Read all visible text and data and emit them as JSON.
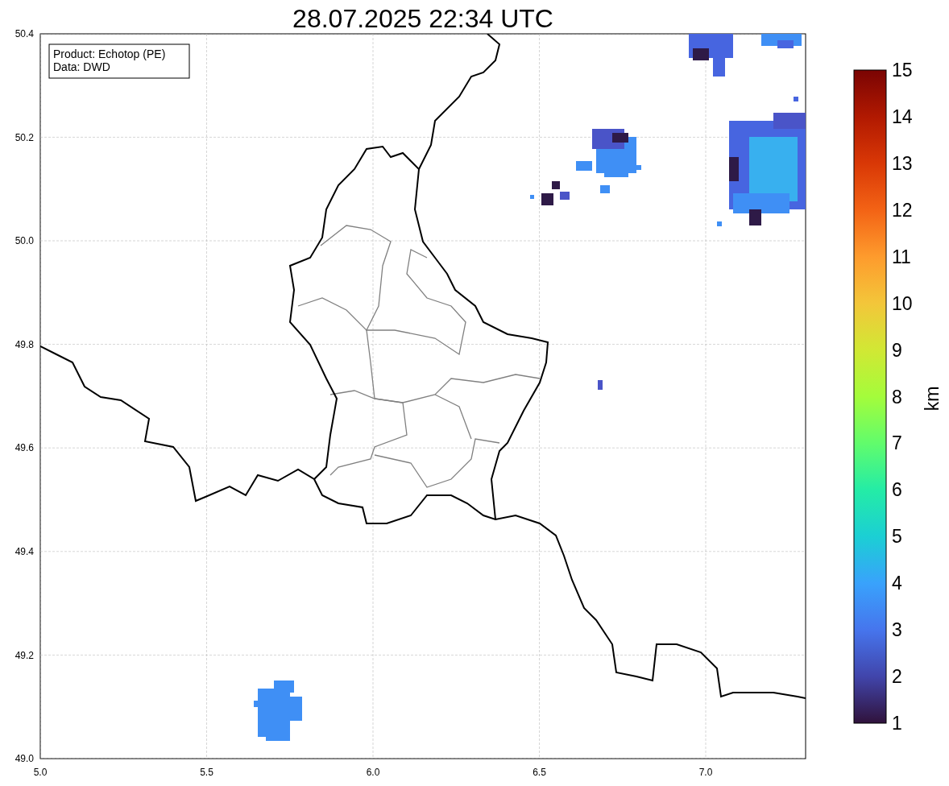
{
  "title": "28.07.2025 22:34 UTC",
  "annotation": [
    "Product: Echotop (PE)",
    "Data: DWD"
  ],
  "xticks": [
    "5.0",
    "5.5",
    "6.0",
    "6.5",
    "7.0"
  ],
  "yticks": [
    "50.4",
    "50.2",
    "50.0",
    "49.8",
    "49.6",
    "49.4",
    "49.2",
    "49.0"
  ],
  "colorbar": {
    "label": "km",
    "ticks": [
      "15",
      "14",
      "13",
      "12",
      "11",
      "10",
      "9",
      "8",
      "7",
      "6",
      "5",
      "4",
      "3",
      "2",
      "1"
    ]
  }
}
